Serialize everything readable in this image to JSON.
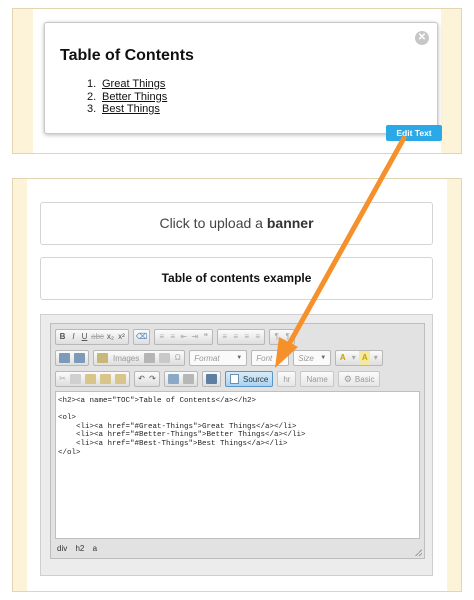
{
  "toc_widget": {
    "title": "Table of Contents",
    "items": [
      {
        "num": "1.",
        "label": "Great Things"
      },
      {
        "num": "2.",
        "label": "Better Things"
      },
      {
        "num": "3.",
        "label": "Best Things"
      }
    ],
    "close_glyph": "✕",
    "edit_button": "Edit Text"
  },
  "banner": {
    "prefix": "Click to upload a ",
    "bold": "banner"
  },
  "heading": "Table of contents example",
  "editor": {
    "toolbar_row1": [
      "B",
      "I",
      "U",
      "abc",
      "x₂",
      "x²",
      "⌫",
      "≡",
      "≡",
      "⇤",
      "⇥",
      "❝",
      "≡",
      "≡",
      "≡",
      "≡",
      "¶",
      "¶"
    ],
    "images_label": "Images",
    "format_label": "Format",
    "font_label": "Font",
    "size_label": "Size",
    "text_color_label": "A",
    "bg_color_label": "A",
    "source_label": "Source",
    "hr_label": "hr",
    "name_label": "Name",
    "basic_label": "Basic",
    "source_code": "<h2><a name=\"TOC\">Table of Contents</a></h2>\n\n<ol>\n    <li><a href=\"#Great-Things\">Great Things</a></li>\n    <li><a href=\"#Better-Things\">Better Things</a></li>\n    <li><a href=\"#Best-Things\">Best Things</a></li>\n</ol>",
    "status_path": [
      "div",
      "h2",
      "a"
    ]
  },
  "colors": {
    "panel_bg": "#fdf3d8",
    "edit_button": "#2aa9e6",
    "arrow": "#f6902a",
    "source_button": "#a9d3f3"
  }
}
